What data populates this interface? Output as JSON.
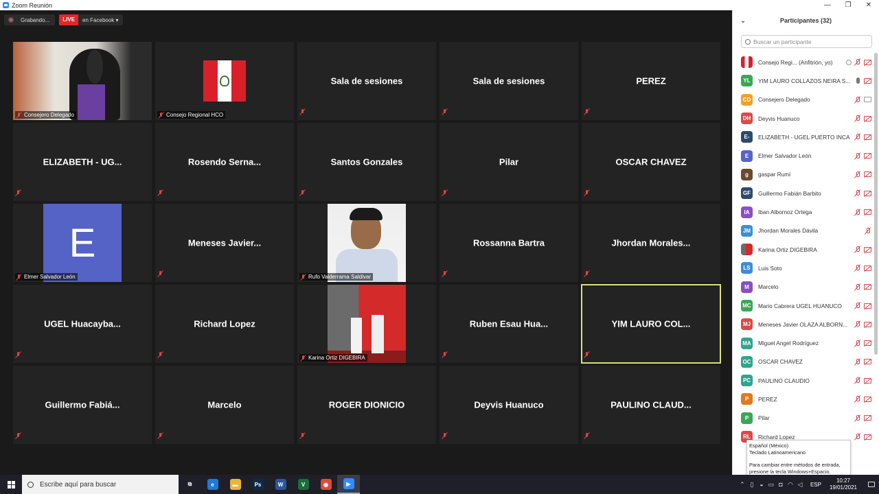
{
  "window": {
    "title": "Zoom Reunión",
    "minimize": "—",
    "restore": "❐",
    "close": "✕"
  },
  "recording": {
    "status": "Grabando...",
    "live_badge": "LIVE",
    "live_dest": "en Facebook ▾"
  },
  "tiles": [
    {
      "name": "",
      "label": "Consejero Delegado",
      "kind": "video-consejo"
    },
    {
      "name": "",
      "label": "Consejo Regional HCO",
      "kind": "flag"
    },
    {
      "name": "Sala de sesiones",
      "label": "",
      "kind": "text"
    },
    {
      "name": "Sala de sesiones",
      "label": "",
      "kind": "text"
    },
    {
      "name": "PEREZ",
      "label": "",
      "kind": "text"
    },
    {
      "name": "ELIZABETH - UG...",
      "label": "",
      "kind": "text"
    },
    {
      "name": "Rosendo Serna...",
      "label": "",
      "kind": "text"
    },
    {
      "name": "Santos Gonzales",
      "label": "",
      "kind": "text"
    },
    {
      "name": "Pilar",
      "label": "",
      "kind": "text"
    },
    {
      "name": "OSCAR CHAVEZ",
      "label": "",
      "kind": "text"
    },
    {
      "name": "",
      "label": "Elmer Salvador León",
      "kind": "avatar-e",
      "avatar_letter": "E"
    },
    {
      "name": "Meneses Javier...",
      "label": "",
      "kind": "text"
    },
    {
      "name": "",
      "label": "Rufo Valderrama Saldivar",
      "kind": "video-rufo"
    },
    {
      "name": "Rossanna Bartra",
      "label": "",
      "kind": "text"
    },
    {
      "name": "Jhordan Morales...",
      "label": "",
      "kind": "text"
    },
    {
      "name": "UGEL Huacayba...",
      "label": "",
      "kind": "text"
    },
    {
      "name": "Richard Lopez",
      "label": "",
      "kind": "text"
    },
    {
      "name": "",
      "label": "Karina Ortiz DIGEBIRA",
      "kind": "video-karina"
    },
    {
      "name": "Ruben Esau Hua...",
      "label": "",
      "kind": "text"
    },
    {
      "name": "YIM LAURO COL...",
      "label": "",
      "kind": "text",
      "active": true
    },
    {
      "name": "Guillermo Fabiá...",
      "label": "",
      "kind": "text"
    },
    {
      "name": "Marcelo",
      "label": "",
      "kind": "text"
    },
    {
      "name": "ROGER DIONICIO",
      "label": "",
      "kind": "text"
    },
    {
      "name": "Deyvis Huanuco",
      "label": "",
      "kind": "text"
    },
    {
      "name": "PAULINO CLAUD...",
      "label": "",
      "kind": "text"
    }
  ],
  "panel": {
    "collapse_icon": "⌄",
    "title": "Participantes (32)",
    "search_placeholder": "Buscar un participante"
  },
  "participants": [
    {
      "initials": "",
      "name": "Consejo Regi...  (Anfitrión, yo)",
      "color": "#ffffff",
      "img": "flag",
      "icons": "host"
    },
    {
      "initials": "YL",
      "name": "YIM LAURO COLLAZOS NEIRA S...",
      "color": "#3aa757",
      "icons": "speaking"
    },
    {
      "initials": "CD",
      "name": "Consejero Delegado",
      "color": "#f0a12b",
      "icons": "video"
    },
    {
      "initials": "DH",
      "name": "Deyvis Huanuco",
      "color": "#d94a4a",
      "icons": "muted"
    },
    {
      "initials": "E-",
      "name": "ELIZABETH - UGEL PUERTO INCA",
      "color": "#2e4a6b",
      "icons": "muted"
    },
    {
      "initials": "E",
      "name": "Elmer Salvador León",
      "color": "#5a63c9",
      "icons": "muted"
    },
    {
      "initials": "g",
      "name": "gaspar Rumi",
      "color": "#6b4a2e",
      "icons": "muted"
    },
    {
      "initials": "GF",
      "name": "Guillermo Fabián Barbito",
      "color": "#2e4a6b",
      "icons": "muted"
    },
    {
      "initials": "IA",
      "name": "Iban Albornoz Ortega",
      "color": "#8a4fc4",
      "icons": "muted"
    },
    {
      "initials": "JM",
      "name": "Jhordan Morales Dávila",
      "color": "#3b8fd6",
      "icons": "mic-only"
    },
    {
      "initials": "",
      "name": "Karina Ortiz DIGEBIRA",
      "color": "#a33b3b",
      "img": "photo",
      "icons": "muted"
    },
    {
      "initials": "LS",
      "name": "Luis Soto",
      "color": "#3b8fd6",
      "icons": "muted"
    },
    {
      "initials": "M",
      "name": "Marcelo",
      "color": "#8a4fc4",
      "icons": "muted"
    },
    {
      "initials": "MC",
      "name": "Mario Cabrera  UGEL HUANUCO",
      "color": "#3aa757",
      "icons": "muted"
    },
    {
      "initials": "MJ",
      "name": "Meneses Javier OLAZA ALBORN...",
      "color": "#d94a4a",
      "icons": "muted"
    },
    {
      "initials": "MA",
      "name": "Miguel Angel Rodríguez",
      "color": "#2fa58f",
      "icons": "muted"
    },
    {
      "initials": "OC",
      "name": "OSCAR CHAVEZ",
      "color": "#2fa58f",
      "icons": "muted"
    },
    {
      "initials": "PC",
      "name": "PAULINO CLAUDIO",
      "color": "#2fa58f",
      "icons": "muted"
    },
    {
      "initials": "P",
      "name": "PEREZ",
      "color": "#e07a1f",
      "icons": "muted"
    },
    {
      "initials": "P",
      "name": "Pilar",
      "color": "#3aa757",
      "icons": "muted"
    },
    {
      "initials": "RL",
      "name": "Richard Lopez",
      "color": "#d94a4a",
      "icons": "muted"
    }
  ],
  "ime_tooltip": {
    "line1": "Español (México)",
    "line2": "Teclado Latinoamericano",
    "line3": "Para cambiar entre métodos de entrada, presione la tecla Windows+Espacio."
  },
  "taskbar": {
    "search_placeholder": "Escribe aquí para buscar",
    "apps": [
      {
        "name": "task-view",
        "glyph": "⧉",
        "color": "transparent"
      },
      {
        "name": "edge",
        "glyph": "e",
        "color": "#1f7ad6"
      },
      {
        "name": "file-explorer",
        "glyph": "▬",
        "color": "#e8b63a"
      },
      {
        "name": "photoshop",
        "glyph": "Ps",
        "color": "#0e2a48"
      },
      {
        "name": "word",
        "glyph": "W",
        "color": "#2b5797"
      },
      {
        "name": "vim",
        "glyph": "V",
        "color": "#1b6e3a"
      },
      {
        "name": "chrome",
        "glyph": "◉",
        "color": "#dd4b39"
      },
      {
        "name": "zoom",
        "glyph": "▶",
        "color": "#2d8cff"
      }
    ],
    "lang": "ESP",
    "time": "10:27",
    "date": "19/01/2021"
  }
}
